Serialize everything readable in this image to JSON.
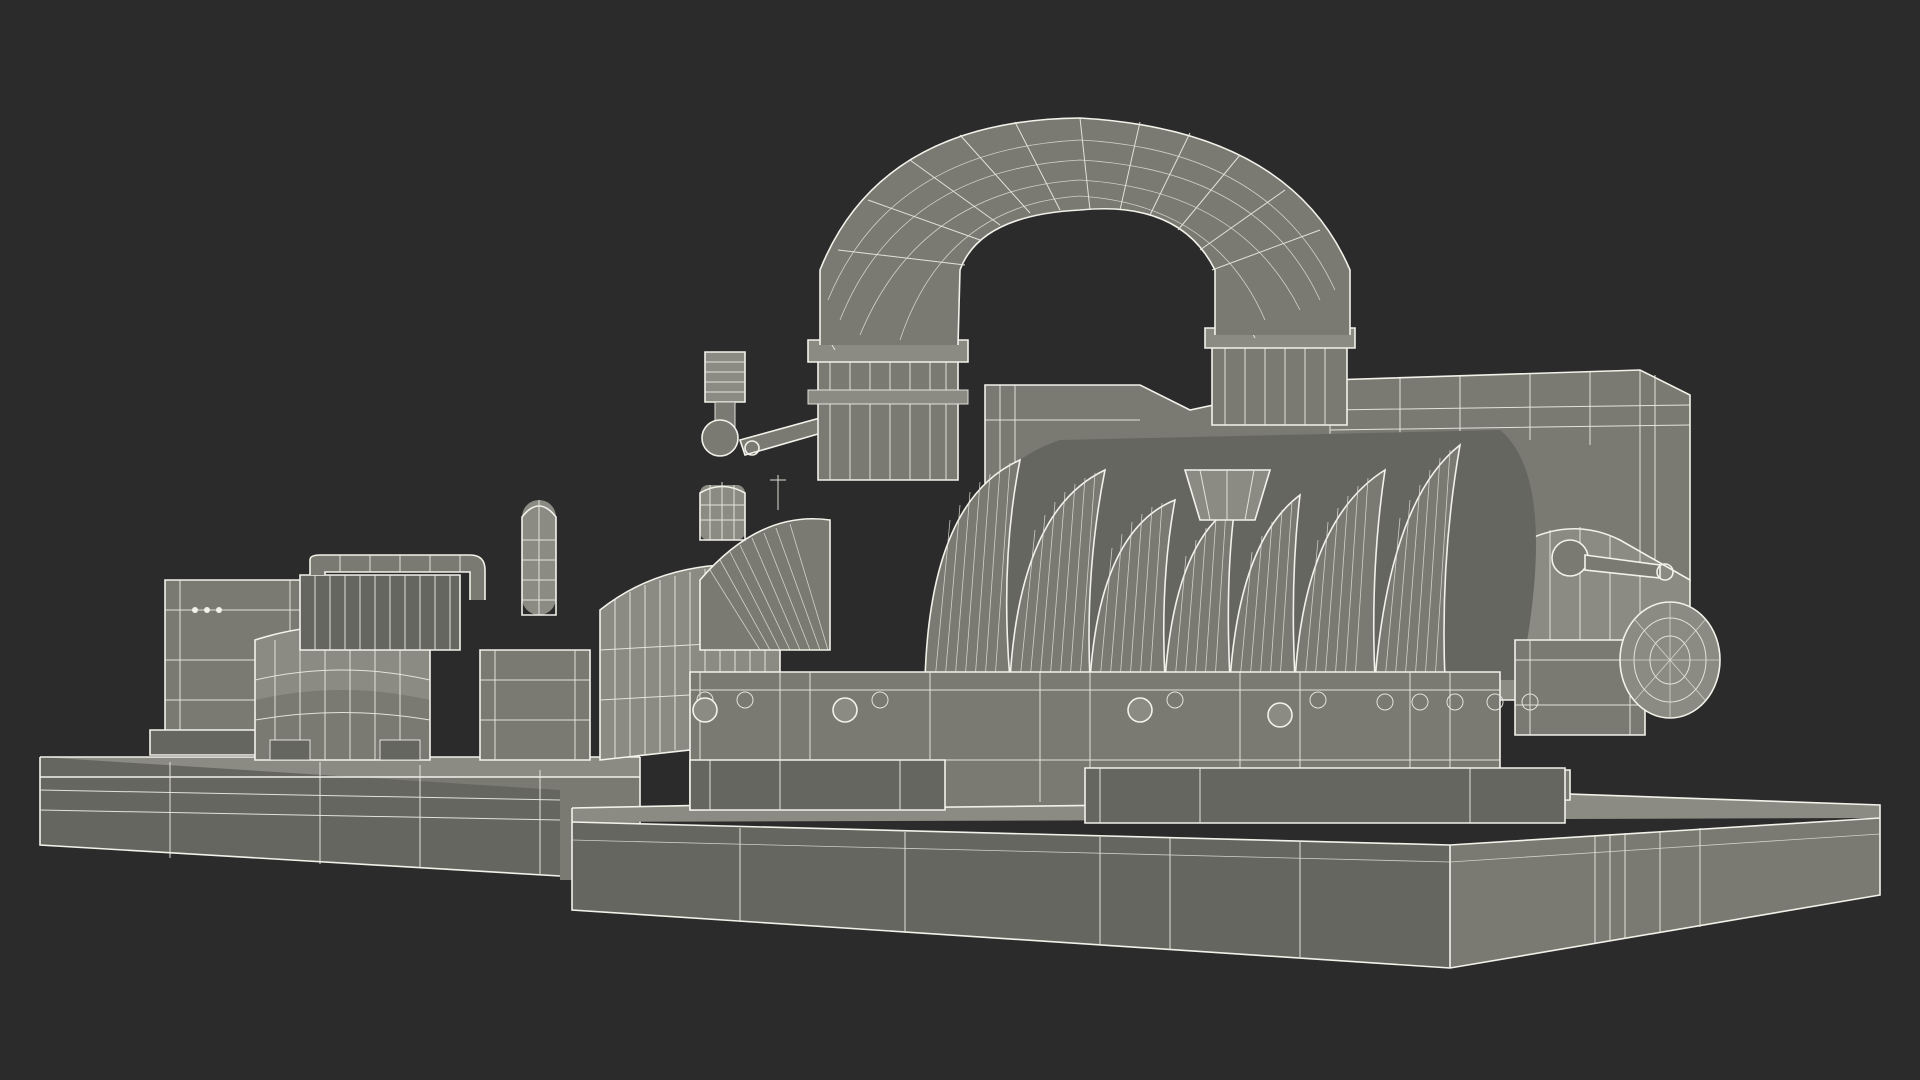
{
  "scene": {
    "background_color": "#2b2b2b",
    "model_fill_color": "#7a7a72",
    "wireframe_color": "#f2f2ea"
  },
  "icons": {
    "viewport": "wireframe-3d-model"
  }
}
